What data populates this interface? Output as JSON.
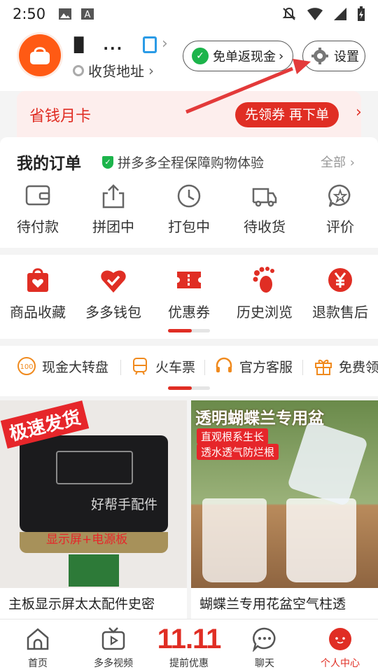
{
  "status_bar": {
    "time": "2:50"
  },
  "profile": {
    "username": "▉  ...",
    "name_tail": "...",
    "address_label": "收货地址",
    "cash_back_label": "免单返现金",
    "settings_label": "设置"
  },
  "money_card": {
    "title": "省钱月卡",
    "action_label": "先领券 再下单"
  },
  "orders": {
    "title": "我的订单",
    "guarantee": "拼多多全程保障购物体验",
    "all_label": "全部",
    "items": [
      {
        "label": "待付款",
        "icon": "wallet-icon"
      },
      {
        "label": "拼团中",
        "icon": "share-box-icon"
      },
      {
        "label": "打包中",
        "icon": "clock-icon"
      },
      {
        "label": "待收货",
        "icon": "truck-icon"
      },
      {
        "label": "评价",
        "icon": "star-bubble-icon"
      }
    ]
  },
  "shortcuts": [
    {
      "label": "商品收藏",
      "icon": "bag-heart-icon"
    },
    {
      "label": "多多钱包",
      "icon": "heart-check-icon"
    },
    {
      "label": "优惠券",
      "icon": "ticket-icon"
    },
    {
      "label": "历史浏览",
      "icon": "footprint-icon"
    },
    {
      "label": "退款售后",
      "icon": "yen-icon"
    }
  ],
  "promos": [
    {
      "label": "现金大转盘",
      "icon": "wheel-100-icon"
    },
    {
      "label": "火车票",
      "icon": "train-icon"
    },
    {
      "label": "官方客服",
      "icon": "headset-icon"
    },
    {
      "label": "免费领",
      "icon": "gift-icon"
    }
  ],
  "products": [
    {
      "title": "主板显示屏太太配件史密",
      "badge": "极速发货",
      "watermark": "好帮手配件",
      "caption": "显示屏+电源板"
    },
    {
      "title": "蝴蝶兰专用花盆空气柱透",
      "headline": "透明蝴蝶兰专用盆",
      "tag1": "直观根系生长",
      "tag2": "透水透气防烂根"
    }
  ],
  "tabbar": [
    {
      "label": "首页",
      "icon": "home-icon"
    },
    {
      "label": "多多视频",
      "icon": "tv-icon"
    },
    {
      "label": "提前优惠",
      "icon_text": "11.11"
    },
    {
      "label": "聊天",
      "icon": "chat-icon"
    },
    {
      "label": "个人中心",
      "icon": "profile-face-icon"
    }
  ],
  "colors": {
    "brand_red": "#e02e24",
    "orange": "#ff5a14",
    "green": "#1cb44b"
  }
}
